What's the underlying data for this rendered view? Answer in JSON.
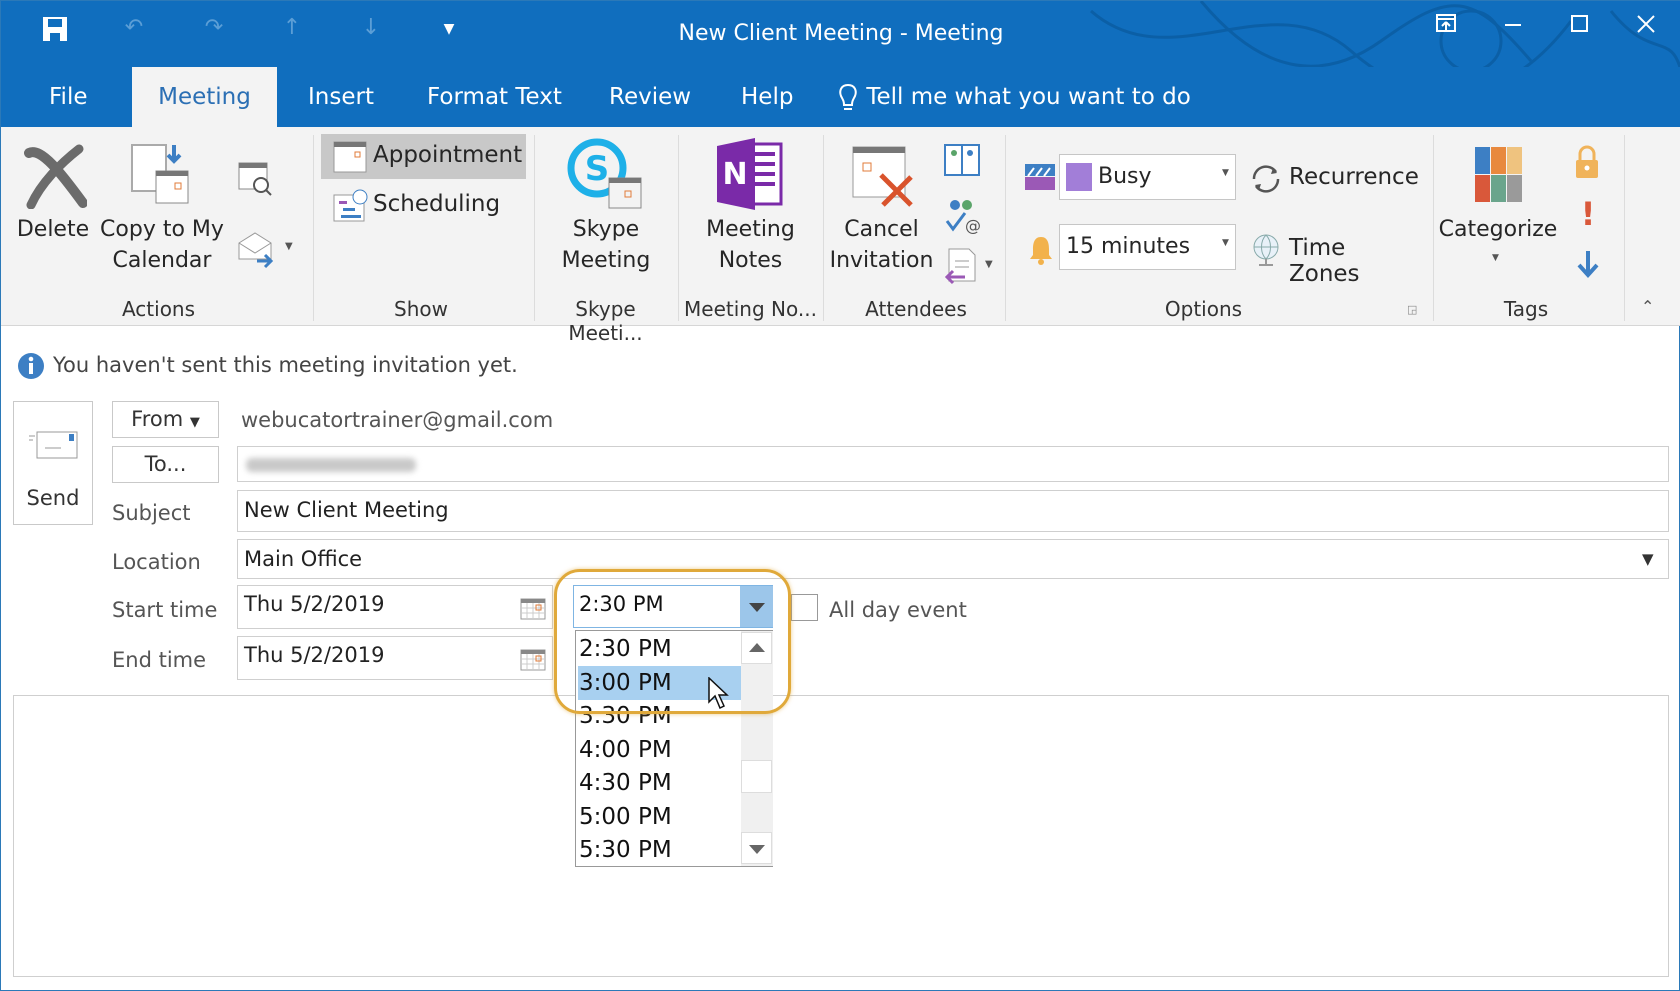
{
  "window": {
    "title": "New Client Meeting  -  Meeting",
    "qat": {
      "save_icon": "save-icon",
      "undo_icon": "undo-icon",
      "redo_icon": "redo-icon",
      "up_icon": "previous-item-icon",
      "down_icon": "next-item-icon",
      "customize_icon": "customize-qat-icon"
    },
    "controls": {
      "restore_ribbon": "ribbon-display-icon",
      "minimize": "minimize-icon",
      "maximize": "maximize-icon",
      "close": "close-icon"
    }
  },
  "tabs": [
    "File",
    "Meeting",
    "Insert",
    "Format Text",
    "Review",
    "Help"
  ],
  "active_tab": "Meeting",
  "tell_me": "Tell me what you want to do",
  "ribbon": {
    "actions": {
      "delete": "Delete",
      "copy_line1": "Copy to My",
      "copy_line2": "Calendar",
      "label": "Actions"
    },
    "show": {
      "appointment": "Appointment",
      "scheduling": "Scheduling",
      "label": "Show"
    },
    "skype": {
      "line1": "Skype",
      "line2": "Meeting",
      "label": "Skype Meeti..."
    },
    "notes": {
      "line1": "Meeting",
      "line2": "Notes",
      "label": "Meeting No..."
    },
    "attendees": {
      "line1": "Cancel",
      "line2": "Invitation",
      "label": "Attendees"
    },
    "options": {
      "show_as": "Busy",
      "reminder": "15 minutes",
      "recurrence": "Recurrence",
      "time_zones": "Time Zones",
      "label": "Options"
    },
    "tags": {
      "categorize": "Categorize",
      "label": "Tags"
    }
  },
  "info_bar": "You haven't sent this meeting invitation yet.",
  "form": {
    "send": "Send",
    "from_button": "From",
    "from_value": "webucatortrainer@gmail.com",
    "to_button": "To...",
    "subject_label": "Subject",
    "subject_value": "New Client Meeting",
    "location_label": "Location",
    "location_value": "Main Office",
    "start_label": "Start time",
    "start_date": "Thu 5/2/2019",
    "start_time": "2:30 PM",
    "end_label": "End time",
    "end_date": "Thu 5/2/2019",
    "all_day_label": "All day event",
    "all_day_checked": false
  },
  "time_dropdown": {
    "options": [
      "2:30 PM",
      "3:00 PM",
      "3:30 PM",
      "4:00 PM",
      "4:30 PM",
      "5:00 PM",
      "5:30 PM"
    ],
    "highlighted": "3:00 PM"
  },
  "colors": {
    "accent": "#106ebe",
    "highlight_ring": "#e0a93a",
    "selection": "#a8d0f0"
  }
}
